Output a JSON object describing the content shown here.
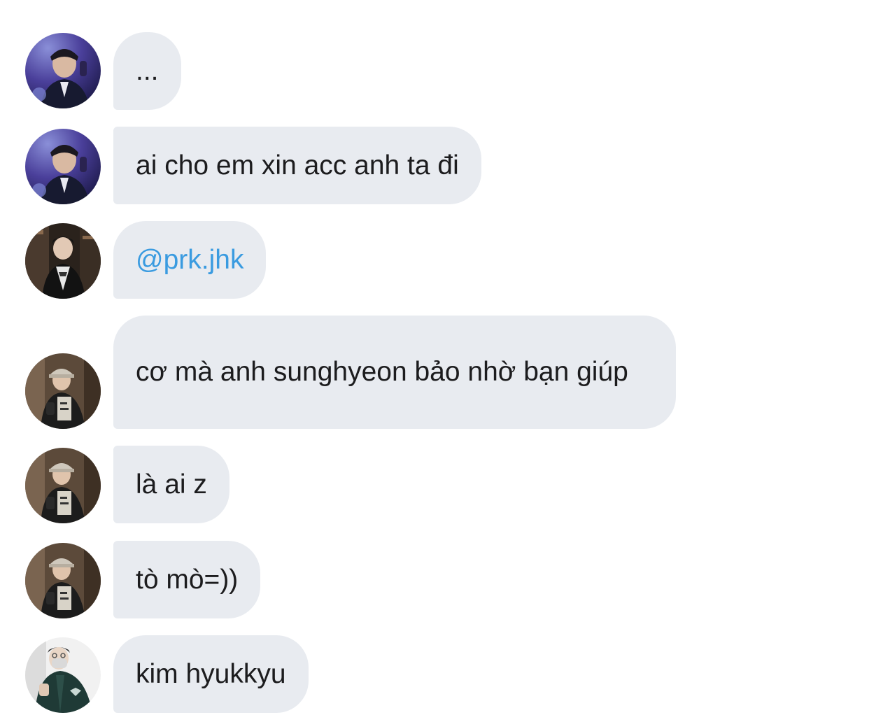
{
  "messages": [
    {
      "avatar": "avatar-user-a",
      "text": "..."
    },
    {
      "avatar": "avatar-user-a",
      "text": "ai cho em xin acc anh ta đi"
    },
    {
      "avatar": "avatar-user-b",
      "text": "@prk.jhk",
      "is_mention": true
    },
    {
      "avatar": "avatar-user-c",
      "text": "cơ mà anh sunghyeon bảo nhờ bạn giúp"
    },
    {
      "avatar": "avatar-user-c",
      "text": "là ai z"
    },
    {
      "avatar": "avatar-user-c",
      "text": "tò mò=))"
    },
    {
      "avatar": "avatar-user-d",
      "text": "kim hyukkyu"
    }
  ],
  "colors": {
    "bubble_bg": "#e8ebf0",
    "text": "#1c1c1e",
    "mention": "#3a9be0"
  }
}
